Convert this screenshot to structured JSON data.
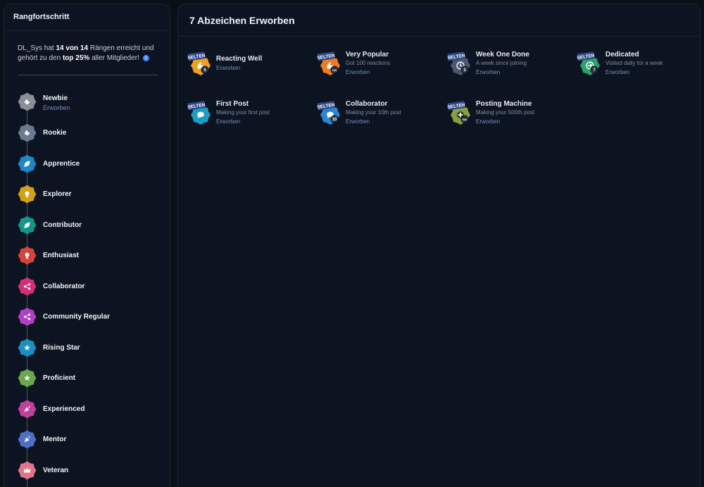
{
  "left": {
    "title": "Rangfortschritt",
    "summary": {
      "user": "DL_Sys",
      "hat": "hat",
      "reached": "14 von 14",
      "mid": "Rängen erreicht und gehört zu den",
      "top": "top 25%",
      "end": "aller Mitglieder!",
      "info_icon": "i"
    },
    "ranks": [
      {
        "name": "Newbie",
        "sub": "Erworben",
        "color": "#8a8f96",
        "icon": "hand-icon"
      },
      {
        "name": "Rookie",
        "sub": "",
        "color": "#6b7a90",
        "icon": "hand-icon"
      },
      {
        "name": "Apprentice",
        "sub": "",
        "color": "#1e88c7",
        "icon": "leaf-icon"
      },
      {
        "name": "Explorer",
        "sub": "",
        "color": "#d4a017",
        "icon": "bulb-icon"
      },
      {
        "name": "Contributor",
        "sub": "",
        "color": "#14968a",
        "icon": "leaf-icon"
      },
      {
        "name": "Enthusiast",
        "sub": "",
        "color": "#d8433b",
        "icon": "bulb-icon"
      },
      {
        "name": "Collaborator",
        "sub": "",
        "color": "#d62f7a",
        "icon": "share-icon"
      },
      {
        "name": "Community Regular",
        "sub": "",
        "color": "#b43fc7",
        "icon": "share-icon"
      },
      {
        "name": "Rising Star",
        "sub": "",
        "color": "#1d8fc2",
        "icon": "star-icon"
      },
      {
        "name": "Proficient",
        "sub": "",
        "color": "#6aa84f",
        "icon": "star-icon"
      },
      {
        "name": "Experienced",
        "sub": "",
        "color": "#c2409c",
        "icon": "party-icon"
      },
      {
        "name": "Mentor",
        "sub": "",
        "color": "#4f6fc7",
        "icon": "party-icon"
      },
      {
        "name": "Veteran",
        "sub": "",
        "color": "#e0758a",
        "icon": "crown-icon"
      }
    ]
  },
  "right": {
    "title": "7 Abzeichen Erworben",
    "achievements": [
      {
        "title": "Reacting Well",
        "desc": "",
        "status": "Erworben",
        "tag": "SELTEN",
        "count": "5",
        "color": "#f0a020",
        "icon": "thumbs-up-icon"
      },
      {
        "title": "Very Popular",
        "desc": "Got 100 reactions",
        "status": "Erworben",
        "tag": "SELTEN",
        "count": "100",
        "color": "#f07a20",
        "icon": "thumbs-up-icon"
      },
      {
        "title": "Week One Done",
        "desc": "A week since joining",
        "status": "Erworben",
        "tag": "SELTEN",
        "count": "3",
        "color": "#4a5870",
        "icon": "clock-icon"
      },
      {
        "title": "Dedicated",
        "desc": "Visited daily for a week",
        "status": "Erworben",
        "tag": "SELTEN",
        "count": "7",
        "color": "#2aa36a",
        "icon": "login-icon"
      },
      {
        "title": "First Post",
        "desc": "Making your first post",
        "status": "Erworben",
        "tag": "SELTEN",
        "count": "",
        "color": "#1a9ec4",
        "icon": "chat-icon"
      },
      {
        "title": "Collaborator",
        "desc": "Making your 10th post",
        "status": "Erworben",
        "tag": "SELTEN",
        "count": "10",
        "color": "#2a86d4",
        "icon": "chat-icon"
      },
      {
        "title": "Posting Machine",
        "desc": "Making your 500th post",
        "status": "Erworben",
        "tag": "SELTEN",
        "count": "500",
        "color": "#8aa040",
        "icon": "plus-icon"
      }
    ]
  }
}
